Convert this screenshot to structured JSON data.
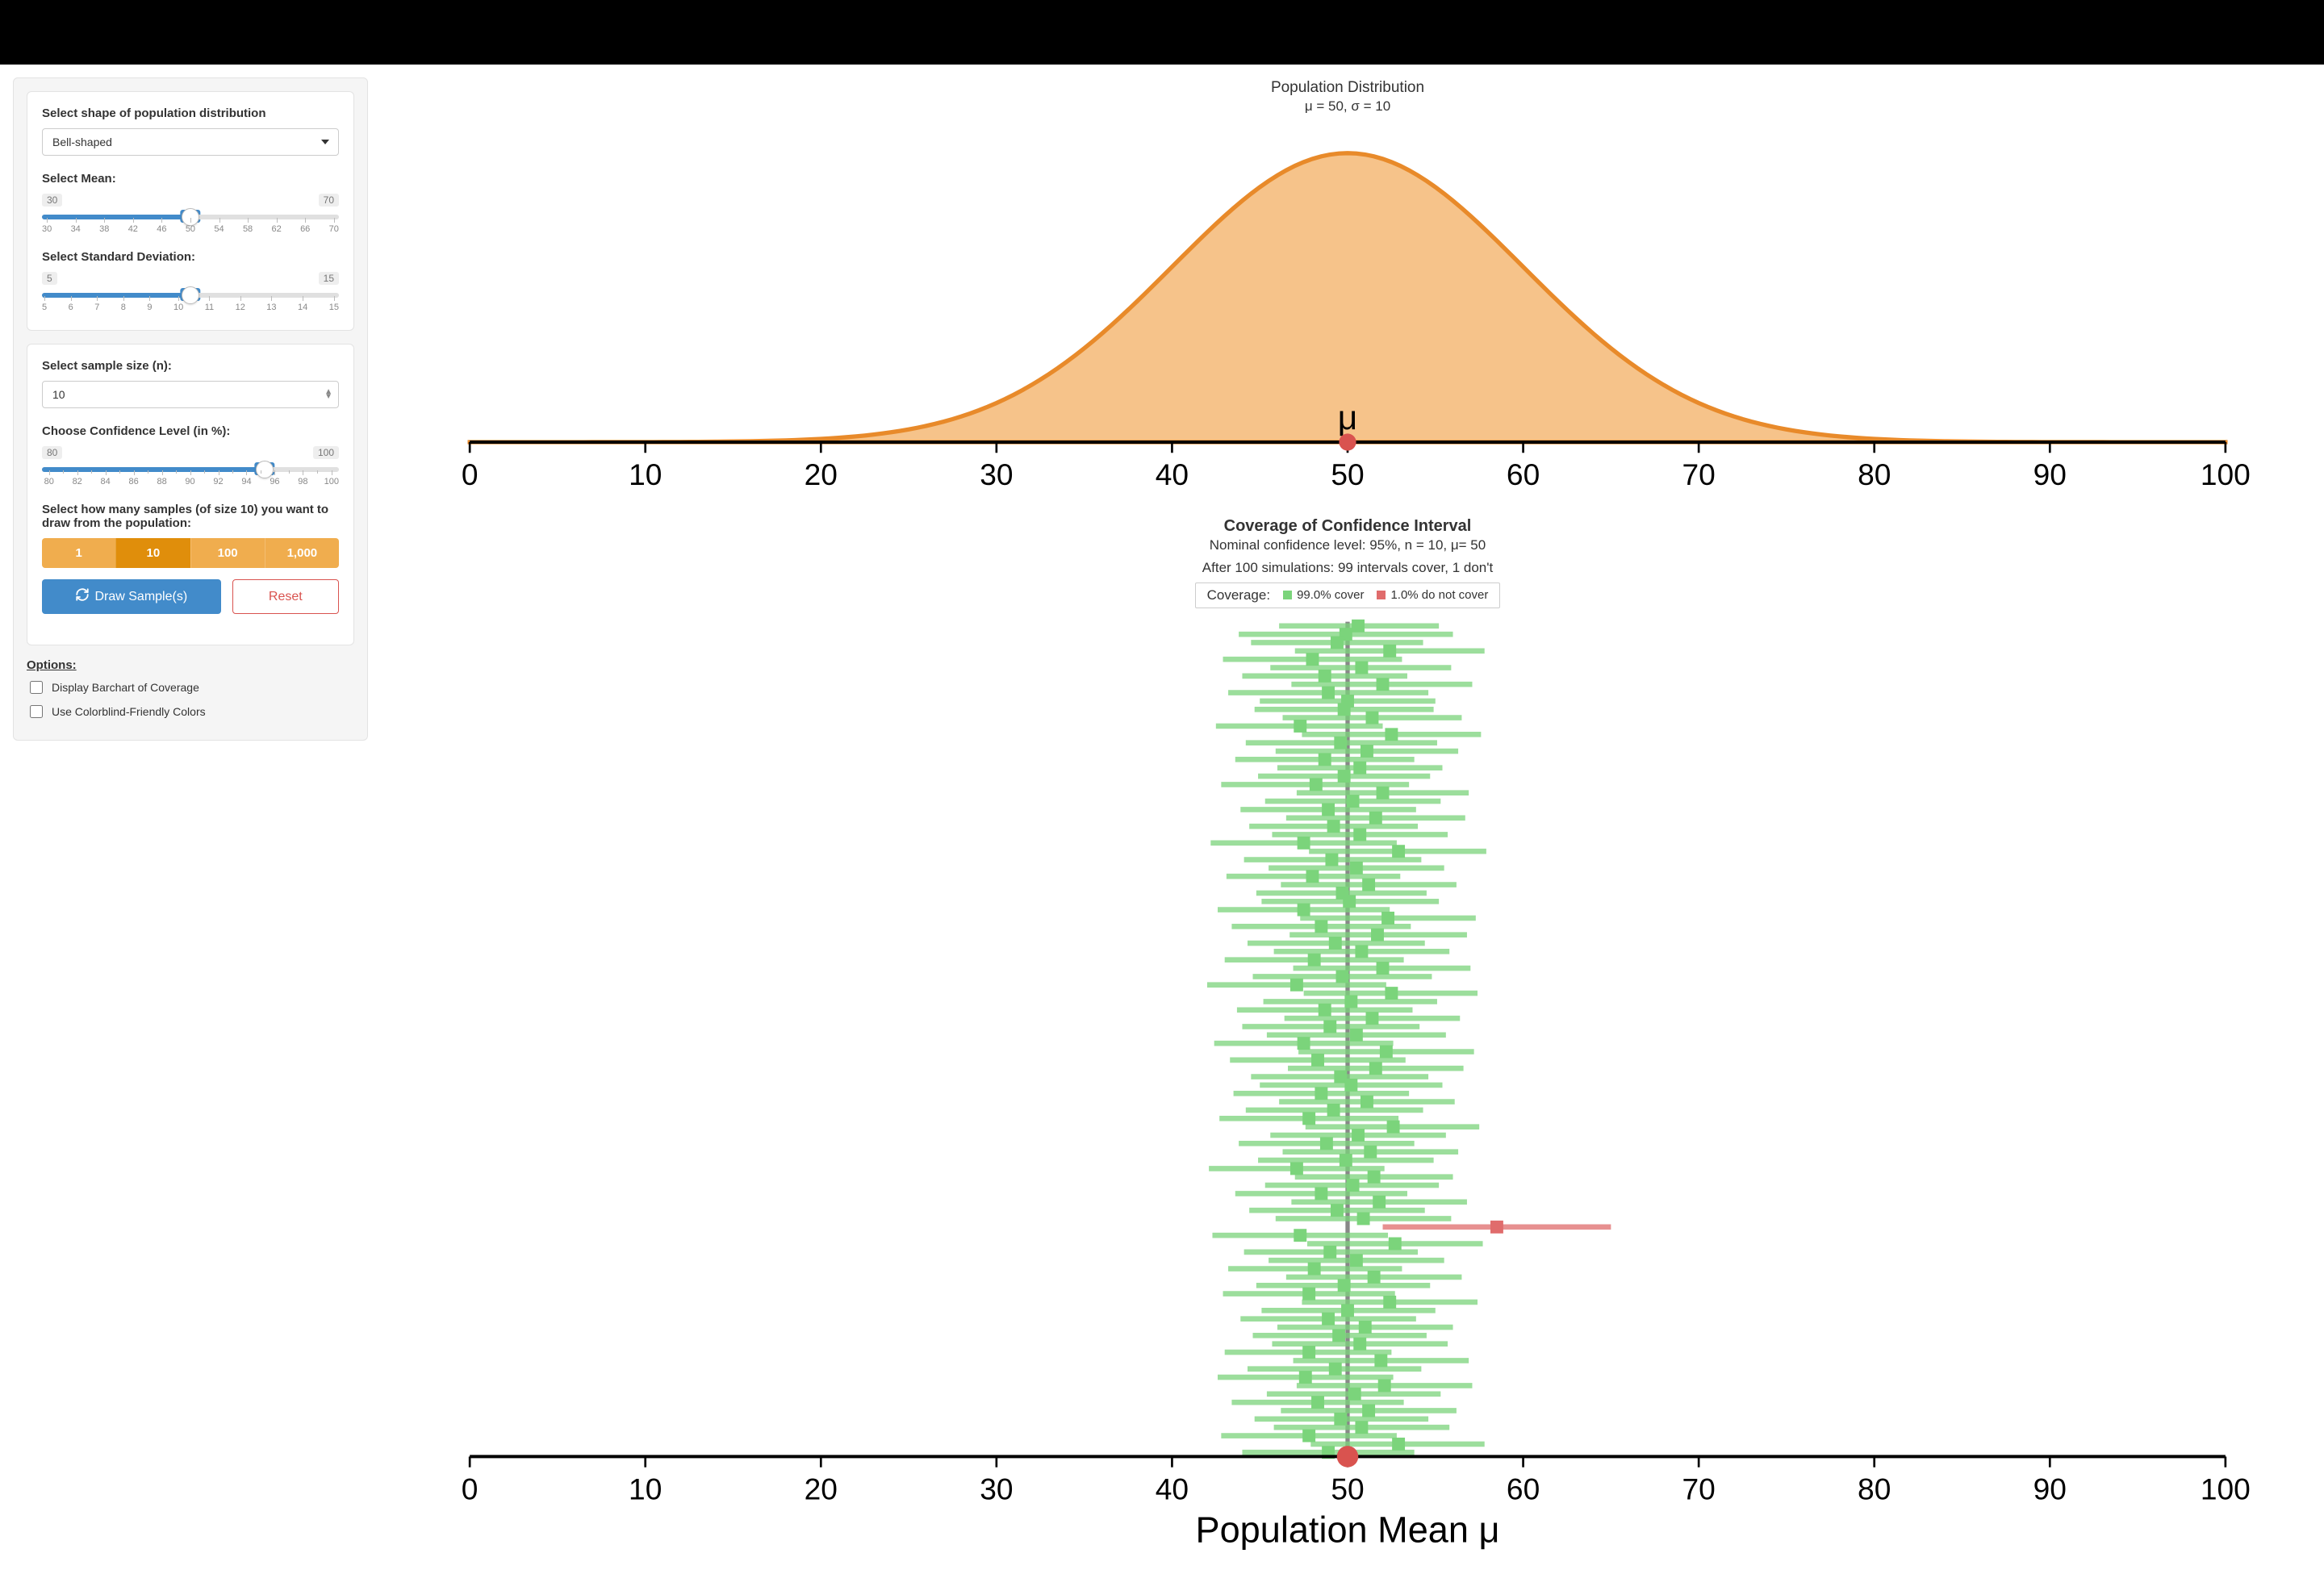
{
  "sidebar": {
    "shape": {
      "label": "Select shape of population distribution",
      "value": "Bell-shaped"
    },
    "mean": {
      "label": "Select Mean:",
      "min": 30,
      "max": 70,
      "value": 50,
      "ticks": [
        30,
        34,
        38,
        42,
        46,
        50,
        54,
        58,
        62,
        66,
        70
      ]
    },
    "sd": {
      "label": "Select Standard Deviation:",
      "min": 5,
      "max": 15,
      "value": 10,
      "ticks": [
        5,
        6,
        7,
        8,
        9,
        10,
        11,
        12,
        13,
        14,
        15
      ]
    },
    "n": {
      "label": "Select sample size (n):",
      "value": "10"
    },
    "conf": {
      "label": "Choose Confidence Level (in %):",
      "min": 80,
      "max": 100,
      "value": 95,
      "ticks": [
        80,
        82,
        84,
        86,
        88,
        90,
        92,
        94,
        96,
        98,
        100
      ]
    },
    "samples": {
      "label": "Select how many samples (of size 10) you want to draw from the population:",
      "options": [
        "1",
        "10",
        "100",
        "1,000"
      ],
      "selected": "10"
    },
    "draw_label": "Draw Sample(s)",
    "reset_label": "Reset",
    "options_heading": "Options:",
    "opt_barchart": "Display Barchart of Coverage",
    "opt_colorblind": "Use Colorblind-Friendly Colors"
  },
  "chart_data": [
    {
      "type": "area",
      "title": "Population Distribution",
      "subtitle": "μ = 50, σ = 10",
      "mean": 50,
      "sd": 10,
      "mu_label": "μ",
      "x_ticks": [
        0,
        10,
        20,
        30,
        40,
        50,
        60,
        70,
        80,
        90,
        100
      ],
      "xlim": [
        0,
        100
      ],
      "colors": {
        "fill": "#f6c38a",
        "stroke": "#e88a2a",
        "mean_point": "#d9534f"
      }
    },
    {
      "type": "interval",
      "title": "Coverage of Confidence Interval",
      "subtitle1": "Nominal confidence level: 95%, n = 10, μ= 50",
      "subtitle2": "After 100 simulations: 99 intervals cover, 1 don't",
      "legend": {
        "label": "Coverage:",
        "cover_text": "99.0% cover",
        "nocover_text": "1.0% do not cover",
        "cover_color": "#7bd47b",
        "nocover_color": "#e06c6c"
      },
      "x_ticks": [
        0,
        10,
        20,
        30,
        40,
        50,
        60,
        70,
        80,
        90,
        100
      ],
      "xlabel": "Population Mean μ",
      "xlim": [
        0,
        100
      ],
      "mu": 50,
      "n_sim": 100,
      "n_cover": 99,
      "n_nocover": 1,
      "intervals": [
        {
          "lo": 46.1,
          "hi": 55.2,
          "pt": 50.6,
          "cov": true
        },
        {
          "lo": 43.8,
          "hi": 56.0,
          "pt": 49.9,
          "cov": true
        },
        {
          "lo": 44.5,
          "hi": 54.3,
          "pt": 49.4,
          "cov": true
        },
        {
          "lo": 47.0,
          "hi": 57.8,
          "pt": 52.4,
          "cov": true
        },
        {
          "lo": 42.9,
          "hi": 53.1,
          "pt": 48.0,
          "cov": true
        },
        {
          "lo": 45.6,
          "hi": 55.9,
          "pt": 50.8,
          "cov": true
        },
        {
          "lo": 44.0,
          "hi": 53.4,
          "pt": 48.7,
          "cov": true
        },
        {
          "lo": 46.8,
          "hi": 57.1,
          "pt": 52.0,
          "cov": true
        },
        {
          "lo": 43.2,
          "hi": 54.6,
          "pt": 48.9,
          "cov": true
        },
        {
          "lo": 45.0,
          "hi": 55.0,
          "pt": 50.0,
          "cov": true
        },
        {
          "lo": 44.7,
          "hi": 54.9,
          "pt": 49.8,
          "cov": true
        },
        {
          "lo": 46.3,
          "hi": 56.5,
          "pt": 51.4,
          "cov": true
        },
        {
          "lo": 42.5,
          "hi": 52.0,
          "pt": 47.3,
          "cov": true
        },
        {
          "lo": 47.4,
          "hi": 57.6,
          "pt": 52.5,
          "cov": true
        },
        {
          "lo": 44.2,
          "hi": 55.1,
          "pt": 49.6,
          "cov": true
        },
        {
          "lo": 45.9,
          "hi": 56.3,
          "pt": 51.1,
          "cov": true
        },
        {
          "lo": 43.6,
          "hi": 53.8,
          "pt": 48.7,
          "cov": true
        },
        {
          "lo": 46.0,
          "hi": 55.4,
          "pt": 50.7,
          "cov": true
        },
        {
          "lo": 44.9,
          "hi": 54.7,
          "pt": 49.8,
          "cov": true
        },
        {
          "lo": 42.8,
          "hi": 53.5,
          "pt": 48.2,
          "cov": true
        },
        {
          "lo": 47.1,
          "hi": 56.9,
          "pt": 52.0,
          "cov": true
        },
        {
          "lo": 45.3,
          "hi": 55.3,
          "pt": 50.3,
          "cov": true
        },
        {
          "lo": 43.9,
          "hi": 53.9,
          "pt": 48.9,
          "cov": true
        },
        {
          "lo": 46.5,
          "hi": 56.7,
          "pt": 51.6,
          "cov": true
        },
        {
          "lo": 44.4,
          "hi": 54.0,
          "pt": 49.2,
          "cov": true
        },
        {
          "lo": 45.7,
          "hi": 55.7,
          "pt": 50.7,
          "cov": true
        },
        {
          "lo": 42.2,
          "hi": 52.8,
          "pt": 47.5,
          "cov": true
        },
        {
          "lo": 47.8,
          "hi": 57.9,
          "pt": 52.9,
          "cov": true
        },
        {
          "lo": 44.1,
          "hi": 54.2,
          "pt": 49.1,
          "cov": true
        },
        {
          "lo": 45.5,
          "hi": 55.5,
          "pt": 50.5,
          "cov": true
        },
        {
          "lo": 43.1,
          "hi": 53.0,
          "pt": 48.0,
          "cov": true
        },
        {
          "lo": 46.2,
          "hi": 56.2,
          "pt": 51.2,
          "cov": true
        },
        {
          "lo": 44.8,
          "hi": 54.5,
          "pt": 49.7,
          "cov": true
        },
        {
          "lo": 45.1,
          "hi": 55.2,
          "pt": 50.1,
          "cov": true
        },
        {
          "lo": 42.6,
          "hi": 52.4,
          "pt": 47.5,
          "cov": true
        },
        {
          "lo": 47.3,
          "hi": 57.3,
          "pt": 52.3,
          "cov": true
        },
        {
          "lo": 43.4,
          "hi": 53.6,
          "pt": 48.5,
          "cov": true
        },
        {
          "lo": 46.7,
          "hi": 56.8,
          "pt": 51.7,
          "cov": true
        },
        {
          "lo": 44.3,
          "hi": 54.4,
          "pt": 49.3,
          "cov": true
        },
        {
          "lo": 45.8,
          "hi": 55.8,
          "pt": 50.8,
          "cov": true
        },
        {
          "lo": 43.0,
          "hi": 53.2,
          "pt": 48.1,
          "cov": true
        },
        {
          "lo": 46.9,
          "hi": 57.0,
          "pt": 52.0,
          "cov": true
        },
        {
          "lo": 44.6,
          "hi": 54.8,
          "pt": 49.7,
          "cov": true
        },
        {
          "lo": 42.0,
          "hi": 52.2,
          "pt": 47.1,
          "cov": true
        },
        {
          "lo": 47.5,
          "hi": 57.4,
          "pt": 52.5,
          "cov": true
        },
        {
          "lo": 45.2,
          "hi": 55.1,
          "pt": 50.2,
          "cov": true
        },
        {
          "lo": 43.7,
          "hi": 53.7,
          "pt": 48.7,
          "cov": true
        },
        {
          "lo": 46.4,
          "hi": 56.4,
          "pt": 51.4,
          "cov": true
        },
        {
          "lo": 44.0,
          "hi": 54.1,
          "pt": 49.0,
          "cov": true
        },
        {
          "lo": 45.4,
          "hi": 55.6,
          "pt": 50.5,
          "cov": true
        },
        {
          "lo": 42.4,
          "hi": 52.6,
          "pt": 47.5,
          "cov": true
        },
        {
          "lo": 47.2,
          "hi": 57.2,
          "pt": 52.2,
          "cov": true
        },
        {
          "lo": 43.3,
          "hi": 53.3,
          "pt": 48.3,
          "cov": true
        },
        {
          "lo": 46.6,
          "hi": 56.6,
          "pt": 51.6,
          "cov": true
        },
        {
          "lo": 44.5,
          "hi": 54.6,
          "pt": 49.6,
          "cov": true
        },
        {
          "lo": 45.0,
          "hi": 55.4,
          "pt": 50.2,
          "cov": true
        },
        {
          "lo": 43.5,
          "hi": 53.5,
          "pt": 48.5,
          "cov": true
        },
        {
          "lo": 46.1,
          "hi": 56.1,
          "pt": 51.1,
          "cov": true
        },
        {
          "lo": 44.2,
          "hi": 54.3,
          "pt": 49.2,
          "cov": true
        },
        {
          "lo": 42.7,
          "hi": 52.9,
          "pt": 47.8,
          "cov": true
        },
        {
          "lo": 47.6,
          "hi": 57.5,
          "pt": 52.6,
          "cov": true
        },
        {
          "lo": 45.6,
          "hi": 55.6,
          "pt": 50.6,
          "cov": true
        },
        {
          "lo": 43.8,
          "hi": 53.8,
          "pt": 48.8,
          "cov": true
        },
        {
          "lo": 46.3,
          "hi": 56.3,
          "pt": 51.3,
          "cov": true
        },
        {
          "lo": 44.9,
          "hi": 54.9,
          "pt": 49.9,
          "cov": true
        },
        {
          "lo": 42.1,
          "hi": 52.1,
          "pt": 47.1,
          "cov": true
        },
        {
          "lo": 47.0,
          "hi": 56.0,
          "pt": 51.5,
          "cov": true
        },
        {
          "lo": 45.3,
          "hi": 55.2,
          "pt": 50.3,
          "cov": true
        },
        {
          "lo": 43.6,
          "hi": 53.4,
          "pt": 48.5,
          "cov": true
        },
        {
          "lo": 46.8,
          "hi": 56.8,
          "pt": 51.8,
          "cov": true
        },
        {
          "lo": 44.4,
          "hi": 54.4,
          "pt": 49.4,
          "cov": true
        },
        {
          "lo": 45.9,
          "hi": 55.9,
          "pt": 50.9,
          "cov": true
        },
        {
          "lo": 52.0,
          "hi": 65.0,
          "pt": 58.5,
          "cov": false
        },
        {
          "lo": 42.3,
          "hi": 52.3,
          "pt": 47.3,
          "cov": true
        },
        {
          "lo": 47.7,
          "hi": 57.7,
          "pt": 52.7,
          "cov": true
        },
        {
          "lo": 44.1,
          "hi": 54.0,
          "pt": 49.0,
          "cov": true
        },
        {
          "lo": 45.5,
          "hi": 55.5,
          "pt": 50.5,
          "cov": true
        },
        {
          "lo": 43.2,
          "hi": 53.1,
          "pt": 48.1,
          "cov": true
        },
        {
          "lo": 46.5,
          "hi": 56.5,
          "pt": 51.5,
          "cov": true
        },
        {
          "lo": 44.8,
          "hi": 54.7,
          "pt": 49.8,
          "cov": true
        },
        {
          "lo": 42.9,
          "hi": 52.7,
          "pt": 47.8,
          "cov": true
        },
        {
          "lo": 47.4,
          "hi": 57.4,
          "pt": 52.4,
          "cov": true
        },
        {
          "lo": 45.1,
          "hi": 55.0,
          "pt": 50.0,
          "cov": true
        },
        {
          "lo": 43.9,
          "hi": 53.9,
          "pt": 48.9,
          "cov": true
        },
        {
          "lo": 46.0,
          "hi": 56.0,
          "pt": 51.0,
          "cov": true
        },
        {
          "lo": 44.6,
          "hi": 54.5,
          "pt": 49.5,
          "cov": true
        },
        {
          "lo": 45.7,
          "hi": 55.7,
          "pt": 50.7,
          "cov": true
        },
        {
          "lo": 43.0,
          "hi": 52.5,
          "pt": 47.8,
          "cov": true
        },
        {
          "lo": 46.9,
          "hi": 56.9,
          "pt": 51.9,
          "cov": true
        },
        {
          "lo": 44.3,
          "hi": 54.2,
          "pt": 49.3,
          "cov": true
        },
        {
          "lo": 42.6,
          "hi": 52.6,
          "pt": 47.6,
          "cov": true
        },
        {
          "lo": 47.1,
          "hi": 57.1,
          "pt": 52.1,
          "cov": true
        },
        {
          "lo": 45.4,
          "hi": 55.3,
          "pt": 50.4,
          "cov": true
        },
        {
          "lo": 43.4,
          "hi": 53.2,
          "pt": 48.3,
          "cov": true
        },
        {
          "lo": 46.2,
          "hi": 56.2,
          "pt": 51.2,
          "cov": true
        },
        {
          "lo": 44.7,
          "hi": 54.6,
          "pt": 49.6,
          "cov": true
        },
        {
          "lo": 45.8,
          "hi": 55.8,
          "pt": 50.8,
          "cov": true
        },
        {
          "lo": 42.8,
          "hi": 52.8,
          "pt": 47.8,
          "cov": true
        },
        {
          "lo": 47.9,
          "hi": 57.8,
          "pt": 52.9,
          "cov": true
        },
        {
          "lo": 44.0,
          "hi": 53.8,
          "pt": 48.9,
          "cov": true
        }
      ]
    }
  ]
}
